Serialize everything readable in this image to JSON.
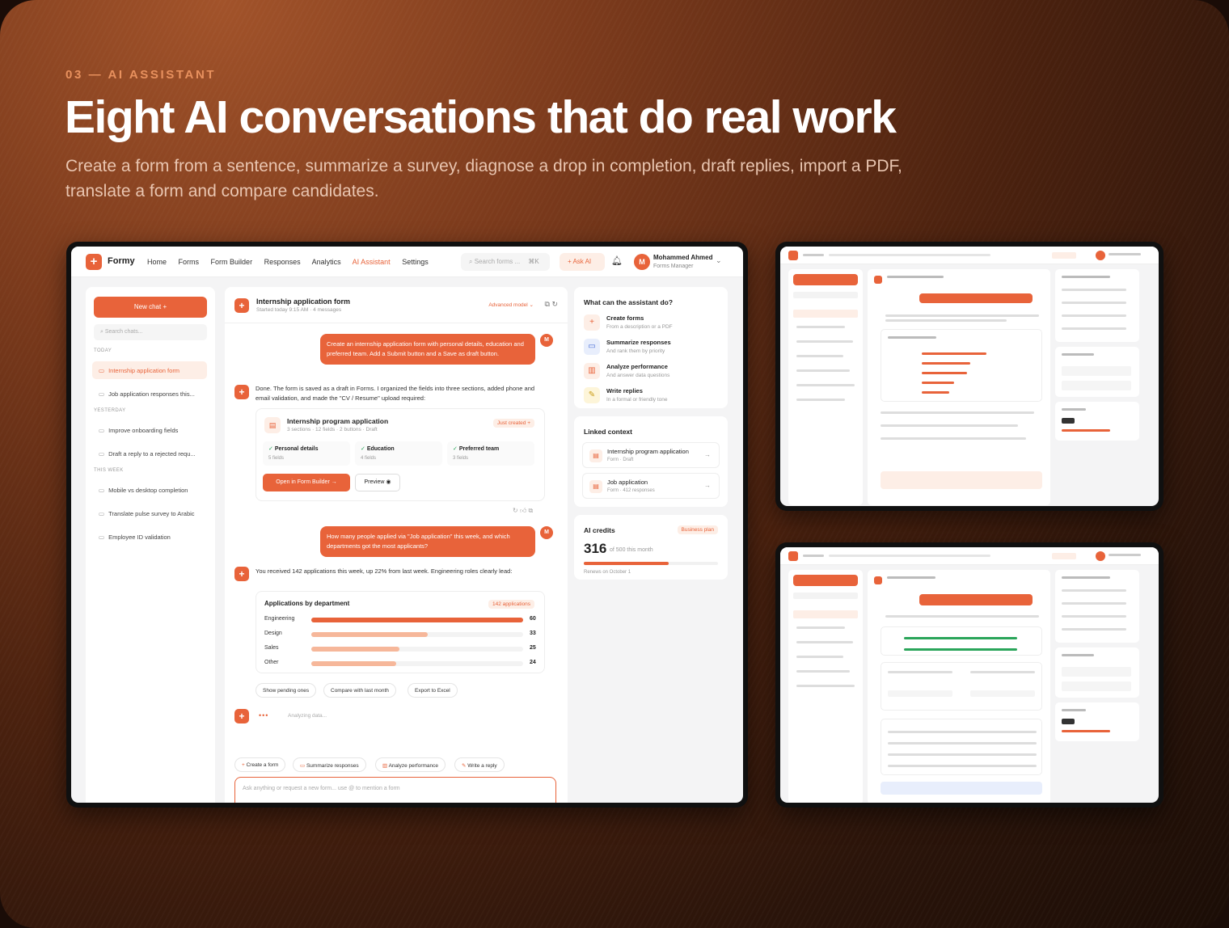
{
  "hero": {
    "kicker": "03 — AI ASSISTANT",
    "title": "Eight AI conversations that do real work",
    "subtitle": "Create a form from a sentence, summarize a survey, diagnose a drop in completion, draft replies, import a PDF, translate a form and compare candidates."
  },
  "app": {
    "brand": "Formy",
    "nav": [
      "Home",
      "Forms",
      "Form Builder",
      "Responses",
      "Analytics",
      "AI Assistant",
      "Settings"
    ],
    "active_nav": "AI Assistant",
    "search_placeholder": "Search forms ...",
    "search_shortcut": "⌘K",
    "ask_ai": "Ask AI",
    "user": {
      "initial": "M",
      "name": "Mohammed Ahmed",
      "role": "Forms Manager"
    }
  },
  "sidebar": {
    "new_chat": "New chat",
    "search_placeholder": "Search chats...",
    "groups": [
      {
        "label": "TODAY",
        "items": [
          "Internship application form",
          "Job application responses this..."
        ]
      },
      {
        "label": "YESTERDAY",
        "items": [
          "Improve onboarding fields",
          "Draft a reply to a rejected requ..."
        ]
      },
      {
        "label": "THIS WEEK",
        "items": [
          "Mobile vs desktop completion",
          "Translate pulse survey to Arabic",
          "Employee ID validation"
        ]
      }
    ],
    "active": "Internship application form"
  },
  "chat": {
    "title": "Internship application form",
    "meta": "Started today 9:15 AM · 4 messages",
    "model": "Advanced model",
    "msg1": "Create an internship application form with personal details, education and preferred team. Add a Submit button and a Save as draft button.",
    "reply1": "Done. The form is saved as a draft in Forms. I organized the fields into three sections, added phone and email validation, and made the \"CV / Resume\" upload required:",
    "form_card": {
      "title": "Internship program application",
      "meta": "3 sections · 12 fields · 2 buttons · Draft",
      "badge": "Just created",
      "sections": [
        {
          "name": "Personal details",
          "count": "5 fields"
        },
        {
          "name": "Education",
          "count": "4 fields"
        },
        {
          "name": "Preferred team",
          "count": "3 fields"
        }
      ],
      "open": "Open in Form Builder",
      "preview": "Preview"
    },
    "msg2": "How many people applied via \"Job application\" this week, and which departments got the most applicants?",
    "reply2": "You received 142 applications this week, up 22% from last week. Engineering roles clearly lead:",
    "chart": {
      "title": "Applications by department",
      "badge": "142 applications"
    },
    "chips": [
      "Show pending ones",
      "Compare with last month",
      "Export to Excel"
    ],
    "analyzing": "Analyzing data...",
    "quick": [
      "Create a form",
      "Summarize responses",
      "Analyze performance",
      "Write a reply"
    ],
    "input_placeholder": "Ask anything or request a new form... use @ to mention a form"
  },
  "chart_data": {
    "type": "bar",
    "title": "Applications by department",
    "categories": [
      "Engineering",
      "Design",
      "Sales",
      "Other"
    ],
    "values": [
      60,
      33,
      25,
      24
    ],
    "xlim": [
      0,
      60
    ]
  },
  "panel": {
    "cap_title": "What can the assistant do?",
    "caps": [
      {
        "t": "Create forms",
        "d": "From a description or a PDF"
      },
      {
        "t": "Summarize responses",
        "d": "And rank them by priority"
      },
      {
        "t": "Analyze performance",
        "d": "And answer data questions"
      },
      {
        "t": "Write replies",
        "d": "In a formal or friendly tone"
      }
    ],
    "linked_title": "Linked context",
    "linked": [
      {
        "t": "Internship program application",
        "d": "Form · Draft"
      },
      {
        "t": "Job application",
        "d": "Form · 412 responses"
      }
    ],
    "credits_title": "AI credits",
    "plan": "Business plan",
    "credits": "316",
    "credits_of": "of 500 this month",
    "credits_used": 0.63,
    "renews": "Renews on October 1"
  },
  "colors": {
    "accent": "#e8633a",
    "accent_soft": "#fdeee6",
    "bar_light": "#f6b79a"
  }
}
